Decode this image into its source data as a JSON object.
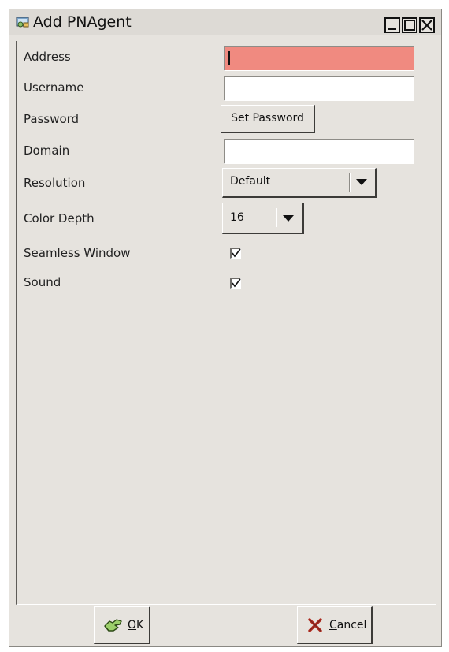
{
  "window": {
    "title": "Add PNAgent",
    "app_icon": "pnagent-app-icon",
    "controls": [
      "minimize-icon",
      "maximize-icon",
      "close-icon"
    ]
  },
  "form": {
    "address": {
      "label": "Address",
      "value": "",
      "state": "error"
    },
    "username": {
      "label": "Username",
      "value": ""
    },
    "password": {
      "label": "Password",
      "button_label": "Set Password"
    },
    "domain": {
      "label": "Domain",
      "value": ""
    },
    "resolution": {
      "label": "Resolution",
      "selected": "Default"
    },
    "color_depth": {
      "label": "Color Depth",
      "selected": "16"
    },
    "seamless_window": {
      "label": "Seamless Window",
      "checked": true
    },
    "sound": {
      "label": "Sound",
      "checked": true
    }
  },
  "footer": {
    "ok": {
      "mnemonic": "O",
      "rest": "K",
      "icon": "ok-hand-icon"
    },
    "cancel": {
      "mnemonic": "C",
      "rest": "ancel",
      "icon": "cancel-x-icon"
    }
  },
  "colors": {
    "error_field": "#f08a80",
    "window_bg": "#e6e3de"
  }
}
